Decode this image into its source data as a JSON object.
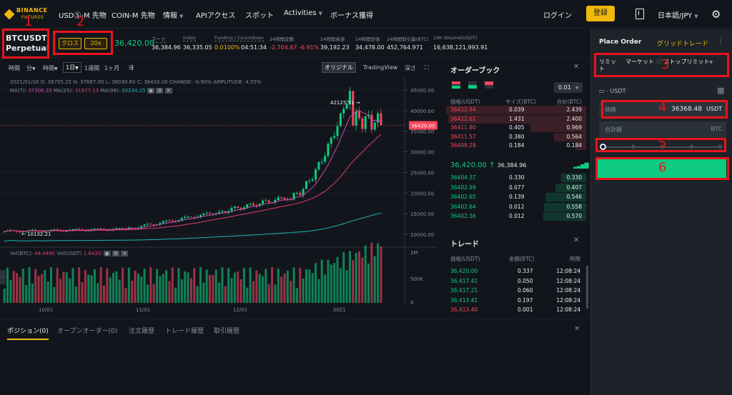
{
  "nav": {
    "logo_top": "BINANCE",
    "logo_bottom": "FUTURES",
    "items": [
      "USDⓈ-M 先物",
      "COIN-M 先物",
      "情報",
      "APIアクセス",
      "スポット",
      "Activities",
      "ボーナス獲得"
    ],
    "login": "ログイン",
    "register": "登録",
    "language": "日本語/JPY"
  },
  "ticker": {
    "symbol_line1": "BTCUSDT",
    "symbol_line2": "Perpetual",
    "margin_mode": "クロス",
    "leverage": "20x",
    "last_price": "36,420.00",
    "mark_label": "マーク",
    "mark_value": "36,384.96",
    "index_label": "Index",
    "index_value": "36,335.05",
    "funding_label": "Funding / Countdown",
    "funding_rate": "0.0100%",
    "countdown": "04:51:34",
    "change_label": "24時間変動",
    "change_value": "-2,704.67 -6.91%",
    "high_label": "24時間高値",
    "high_value": "39,192.23",
    "low_label": "24時間安値",
    "low_value": "34,478.00",
    "vol_btc_label": "24時間取引量(BTC)",
    "vol_btc_value": "452,764.971",
    "vol_usdt_label": "24h Volume(USDT)",
    "vol_usdt_value": "16,638,121,993.91"
  },
  "chart_toolbar": {
    "time": "時間",
    "minute": "分",
    "hour": "時間",
    "day": "1日",
    "week": "1週間",
    "month": "1ヶ月",
    "original": "オリジナル",
    "tradingview": "TradingView",
    "depth": "深さ"
  },
  "chart_info": {
    "ohlc_line": "2021/01/16  O: 36755.25  H: 37687.00  L: 36030.60  C: 36420.00  CHANGE: -0.90%  AMPLITUDE: 4.55%",
    "ma_label_7": "MA(7):",
    "ma_value_7": "37306.20",
    "ma_label_25": "MA(25):",
    "ma_value_25": "31977.13",
    "ma_label_99": "MA(99):",
    "ma_value_99": "20234.25",
    "vol_label": "Vol(BTC):",
    "vol_btc": "44.446K",
    "vol_usdt_label": "Vol(USDT)",
    "vol_usdt": "1.643G",
    "peak_label": "42125.51",
    "low_label": "10132.21",
    "current_tag": "36420.00"
  },
  "chart_data": {
    "type": "candlestick",
    "x_ticks": [
      "10/01",
      "11/01",
      "12/01",
      "2021"
    ],
    "y_ticks": [
      "45000.00",
      "40000.00",
      "35000.00",
      "30000.00",
      "25000.00",
      "20000.00",
      "15000.00",
      "10000.00"
    ],
    "vol_ticks": [
      "1M",
      "500K",
      "0"
    ],
    "ylim": [
      10000,
      45000
    ],
    "series": [
      {
        "name": "MA(7)",
        "color": "#c84db5"
      },
      {
        "name": "MA(25)",
        "color": "#e23a79"
      },
      {
        "name": "MA(99)",
        "color": "#1cb5b5"
      }
    ]
  },
  "orderbook": {
    "title": "オーダーブック",
    "precision": "0.01",
    "col_price": "価格(USDT)",
    "col_size": "サイズ(BTC)",
    "col_total": "合計(BTC)",
    "asks": [
      [
        "36412.94",
        "0.039",
        "2.439"
      ],
      [
        "36412.61",
        "1.431",
        "2.400"
      ],
      [
        "36411.80",
        "0.405",
        "0.969"
      ],
      [
        "36411.57",
        "0.380",
        "0.564"
      ],
      [
        "36409.28",
        "0.184",
        "0.184"
      ]
    ],
    "mid_price": "36,420.00",
    "mid_arrow": "↑",
    "mid_mark": "36,384.96",
    "bids": [
      [
        "36404.37",
        "0.330",
        "0.330"
      ],
      [
        "36402.99",
        "0.077",
        "0.407"
      ],
      [
        "36402.65",
        "0.139",
        "0.546"
      ],
      [
        "36402.64",
        "0.012",
        "0.558"
      ],
      [
        "36402.36",
        "0.012",
        "0.570"
      ]
    ]
  },
  "trades": {
    "title": "トレード",
    "col_price": "価格(USDT)",
    "col_amount": "金額(BTC)",
    "col_time": "時間",
    "rows": [
      [
        "36,420.00",
        "0.337",
        "12:08:24",
        "green"
      ],
      [
        "36,417.41",
        "0.050",
        "12:08:24",
        "green"
      ],
      [
        "36,417.21",
        "0.060",
        "12:08:24",
        "green"
      ],
      [
        "36,413.41",
        "0.197",
        "12:08:24",
        "green"
      ],
      [
        "36,413.40",
        "0.001",
        "12:08:24",
        "red"
      ]
    ]
  },
  "bottom_tabs": [
    "ポジション(0)",
    "オープンオーダー(0)",
    "注文履歴",
    "トレード履歴",
    "取引履歴"
  ],
  "order_panel": {
    "title": "Place Order",
    "grid": "グリッドトレード",
    "type_limit": "リミット",
    "type_market": "マーケット",
    "type_stop": "ストップリミット",
    "balance": "- USDT",
    "price_label": "価格",
    "price_value": "36368.48",
    "price_unit": "USDT",
    "total_label": "合計額",
    "total_unit": "BTC"
  },
  "annotations": [
    "1",
    "2",
    "3",
    "4",
    "5",
    "6"
  ]
}
